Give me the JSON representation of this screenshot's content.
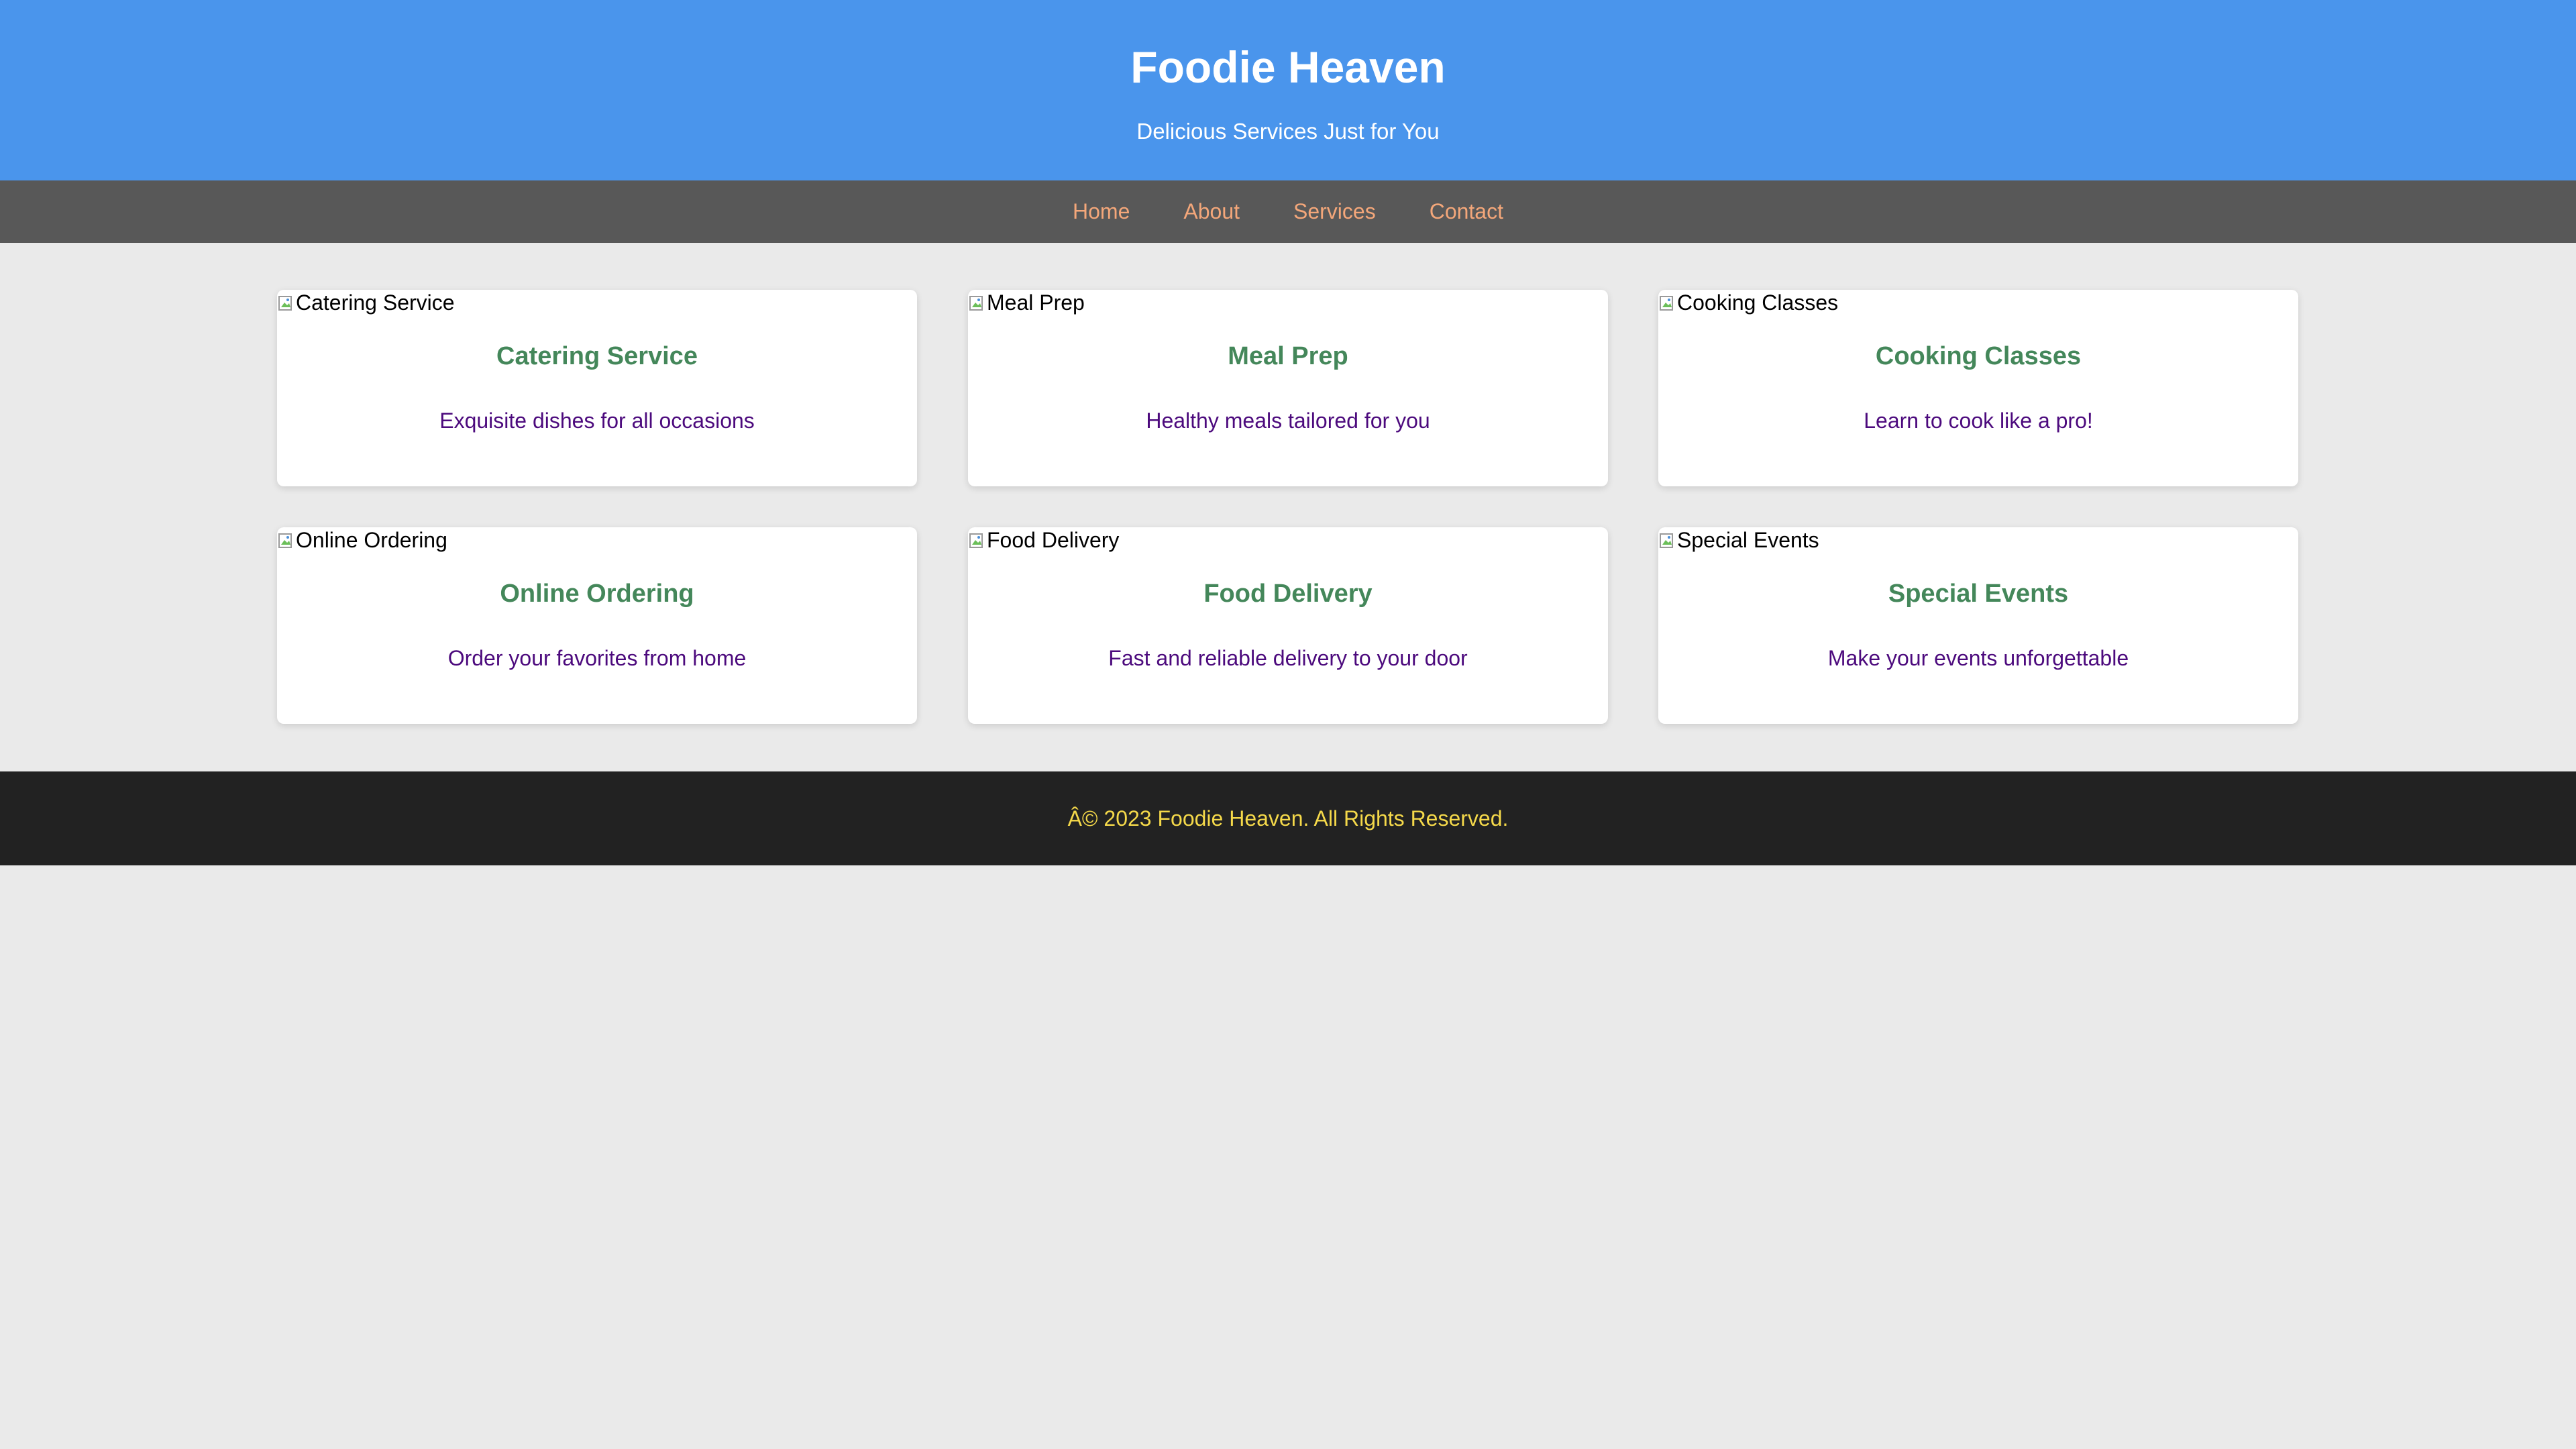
{
  "header": {
    "title": "Foodie Heaven",
    "tagline": "Delicious Services Just for You"
  },
  "nav": {
    "items": [
      {
        "label": "Home"
      },
      {
        "label": "About"
      },
      {
        "label": "Services"
      },
      {
        "label": "Contact"
      }
    ]
  },
  "services": [
    {
      "img_alt": "Catering Service",
      "title": "Catering Service",
      "description": "Exquisite dishes for all occasions"
    },
    {
      "img_alt": "Meal Prep",
      "title": "Meal Prep",
      "description": "Healthy meals tailored for you"
    },
    {
      "img_alt": "Cooking Classes",
      "title": "Cooking Classes",
      "description": "Learn to cook like a pro!"
    },
    {
      "img_alt": "Online Ordering",
      "title": "Online Ordering",
      "description": "Order your favorites from home"
    },
    {
      "img_alt": "Food Delivery",
      "title": "Food Delivery",
      "description": "Fast and reliable delivery to your door"
    },
    {
      "img_alt": "Special Events",
      "title": "Special Events",
      "description": "Make your events unforgettable"
    }
  ],
  "footer": {
    "text": "Â© 2023 Foodie Heaven. All Rights Reserved."
  },
  "colors": {
    "header_bg": "#4a95ec",
    "nav_bg": "#585858",
    "nav_link": "#f4a77a",
    "card_title": "#44875a",
    "card_desc": "#4c0a7d",
    "footer_bg": "#222222",
    "footer_text": "#f5d94a",
    "page_bg": "#eaeaea"
  }
}
